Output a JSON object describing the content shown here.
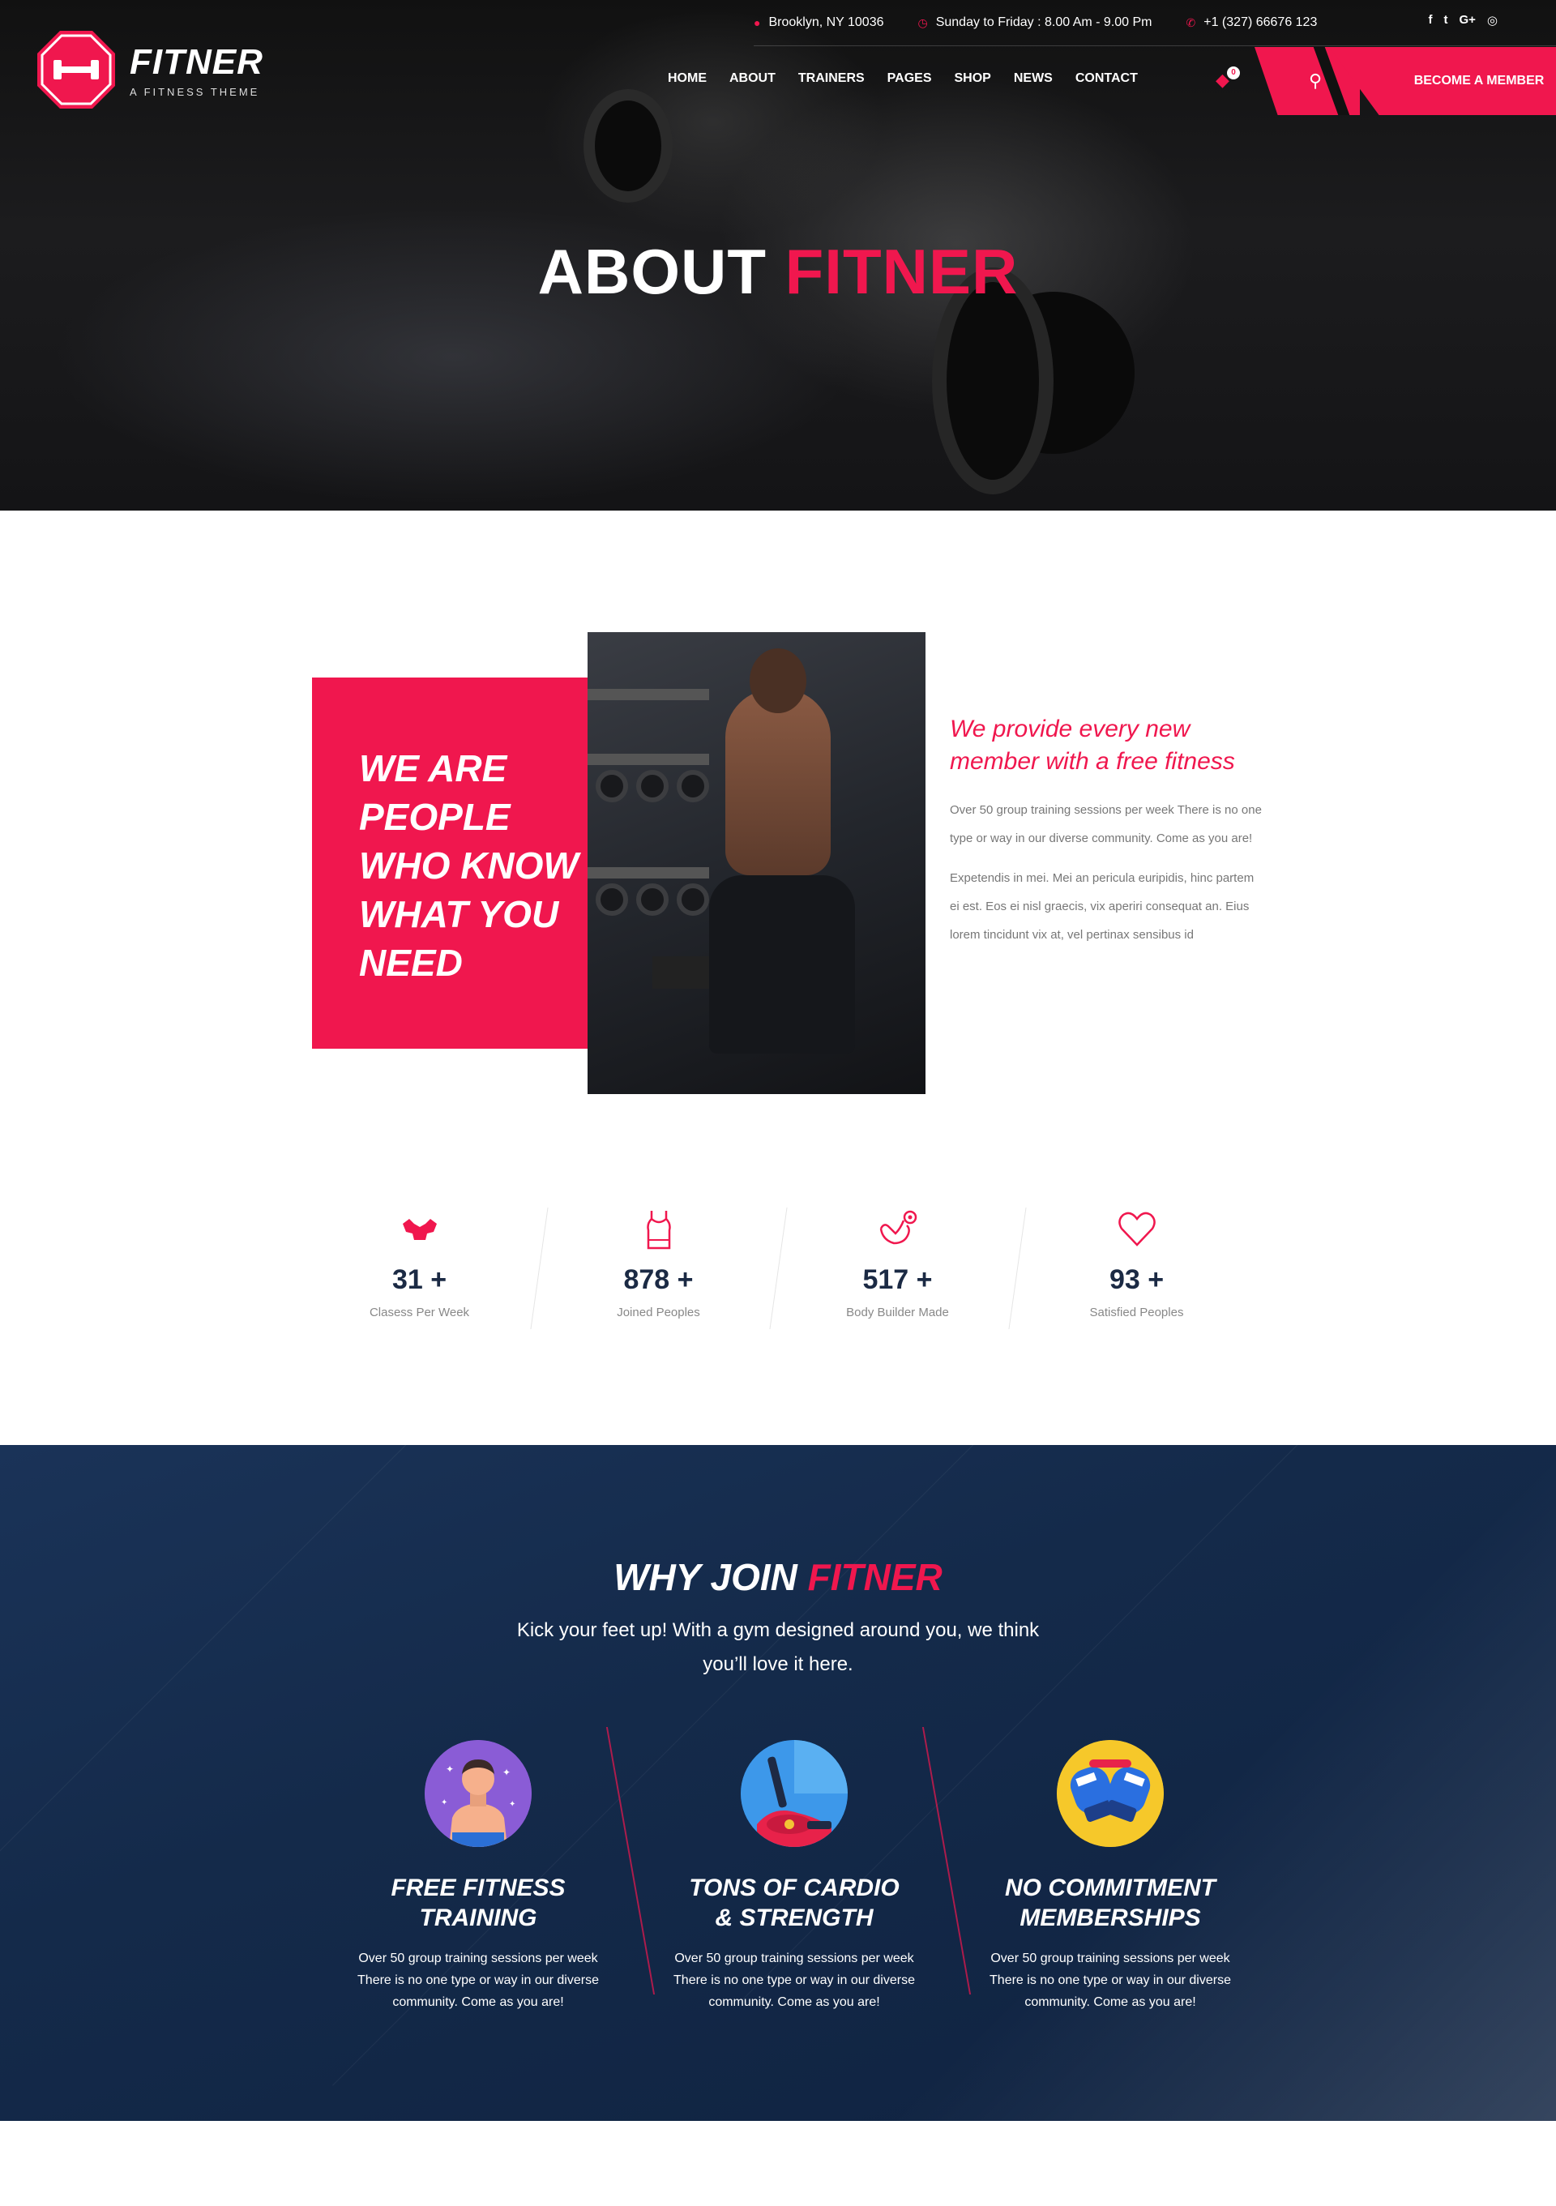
{
  "topbar": {
    "address": "Brooklyn, NY 10036",
    "hours": "Sunday to Friday : 8.00 Am - 9.00 Pm",
    "phone": "+1 (327) 66676 123",
    "socials": [
      "f",
      "t",
      "G+",
      "◎"
    ]
  },
  "brand": {
    "name": "FITNER",
    "tagline": "A FITNESS THEME",
    "accent_color": "#f0174e",
    "navy_color": "#142a4a"
  },
  "nav": {
    "items": [
      "HOME",
      "ABOUT",
      "TRAINERS",
      "PAGES",
      "SHOP",
      "NEWS",
      "CONTACT"
    ],
    "cart_count": "0",
    "cta": "BECOME A MEMBER"
  },
  "hero": {
    "title_main": "ABOUT ",
    "title_accent": "FITNER"
  },
  "about": {
    "card_heading": "WE ARE PEOPLE WHO KNOW WHAT YOU NEED",
    "subheading": "We provide every new member with a free fitness",
    "para1": "Over 50 group training sessions per week There is no one type or way in our diverse community. Come as you are!",
    "para2": "Expetendis in mei. Mei an pericula euripidis, hinc partem ei est. Eos ei nisl graecis, vix aperiri consequat an. Eius lorem tincidunt vix at, vel pertinax sensibus id"
  },
  "stats": [
    {
      "icon": "muscle-icon",
      "value": "31 +",
      "label": "Clasess Per Week"
    },
    {
      "icon": "tank-top-icon",
      "value": "878 +",
      "label": "Joined Peoples"
    },
    {
      "icon": "arm-weight-icon",
      "value": "517 +",
      "label": "Body Builder Made"
    },
    {
      "icon": "heart-icon",
      "value": "93 +",
      "label": "Satisfied Peoples"
    }
  ],
  "why": {
    "title_main": "WHY JOIN ",
    "title_accent": "FITNER",
    "subtitle": "Kick your feet up! With a gym designed around you, we think you’ll love it here.",
    "features": [
      {
        "icon": "trainer-icon",
        "title": "FREE FITNESS TRAINING",
        "text": "Over 50 group training sessions per week There is no one type or way in our diverse community. Come as you are!"
      },
      {
        "icon": "cardio-machine-icon",
        "title": "TONS OF CARDIO & STRENGTH",
        "text": "Over 50 group training sessions per week There is no one type or way in our diverse community. Come as you are!"
      },
      {
        "icon": "boxing-gloves-icon",
        "title": "NO COMMITMENT MEMBERSHIPS",
        "text": "Over 50 group training sessions per week There is no one type or way in our diverse community. Come as you are!"
      }
    ]
  }
}
